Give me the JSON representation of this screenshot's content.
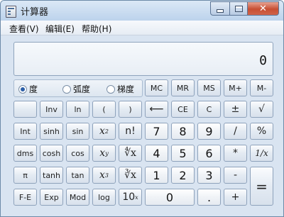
{
  "window": {
    "title": "计算器"
  },
  "menu": [
    "查看(V)",
    "编辑(E)",
    "帮助(H)"
  ],
  "display": {
    "value": "0"
  },
  "angle_modes": [
    {
      "label": "度",
      "selected": true
    },
    {
      "label": "弧度",
      "selected": false
    },
    {
      "label": "梯度",
      "selected": false
    }
  ],
  "memory": [
    "MC",
    "MR",
    "MS",
    "M+",
    "M-"
  ],
  "keys": {
    "blank": "",
    "inv": "Inv",
    "ln": "ln",
    "lparen": "(",
    "rparen": ")",
    "back": "⟵",
    "ce": "CE",
    "c": "C",
    "pm": "±",
    "sqrt": "√",
    "int": "Int",
    "sinh": "sinh",
    "sin": "sin",
    "x": "x",
    "two": "2",
    "fact": "n!",
    "seven": "7",
    "eight": "8",
    "nine": "9",
    "div": "/",
    "pct": "%",
    "dms": "dms",
    "cosh": "cosh",
    "cos": "cos",
    "y": "y",
    "ysqrt": "∜x",
    "four": "4",
    "five": "5",
    "six": "6",
    "mul": "*",
    "recip": "1/x",
    "pi": "π",
    "tanh": "tanh",
    "tan": "tan",
    "three_sup": "3",
    "cbrt": "∛x",
    "one": "1",
    "two_key": "2",
    "three": "3",
    "sub": "-",
    "fe": "F-E",
    "exp": "Exp",
    "mod": "Mod",
    "log": "log",
    "ten": "10",
    "xsup": "x",
    "zero": "0",
    "dot": ".",
    "add": "+",
    "eq": "="
  }
}
